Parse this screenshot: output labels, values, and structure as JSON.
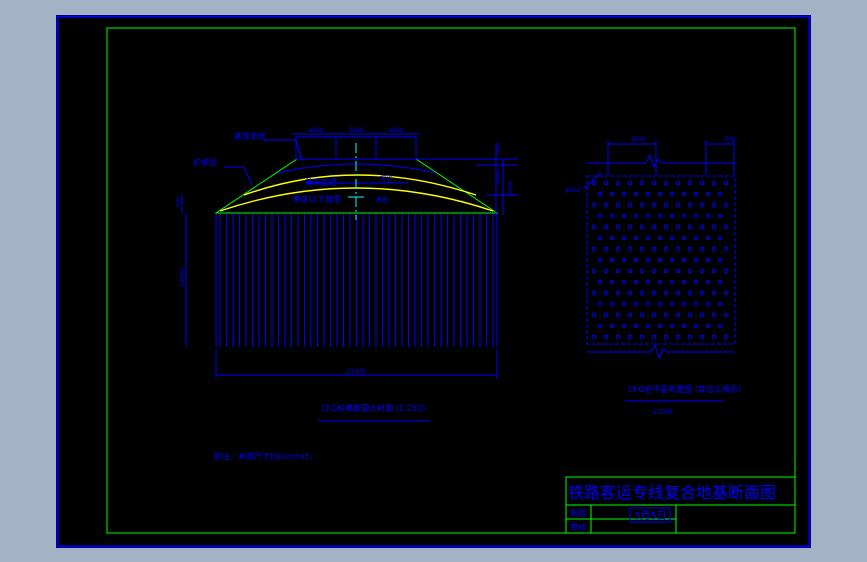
{
  "colors": {
    "background": "#000000",
    "outer_frame": "#0000ff",
    "border": "#00ff00",
    "geometry": "#0000ff",
    "layer_line": "#ffff00",
    "soil_outline": "#00ff00",
    "centerline": "#00ffff"
  },
  "section": {
    "labels": {
      "base_layer": "基床表层",
      "protection": "护坡层",
      "bedding": "垫层",
      "base_bottom": "基床底层",
      "embankment": "基床以下路堤",
      "slope": "坡顶",
      "subgrade": "路基"
    },
    "top_dims": [
      "4000",
      "3000",
      "4000"
    ],
    "side_dims": [
      "800",
      "2300",
      "5000"
    ],
    "left_dim": "500",
    "pile_length": "16000",
    "bottom_width": "31300",
    "caption": "CFG桩横断面大样图 (1:250)"
  },
  "plan": {
    "dim_left": "1600",
    "dim_right": "600",
    "pile_dia": "φ500",
    "caption": "CFG桩平面布置图 (等边三角形)",
    "scale": "1:200"
  },
  "note": "附注：本图尺寸均以mm计。",
  "title_block": {
    "title": "铁路客运专线复合地基断面图",
    "row1_label": "制图",
    "row1_value": "3月5日",
    "row2_label": "审核"
  }
}
